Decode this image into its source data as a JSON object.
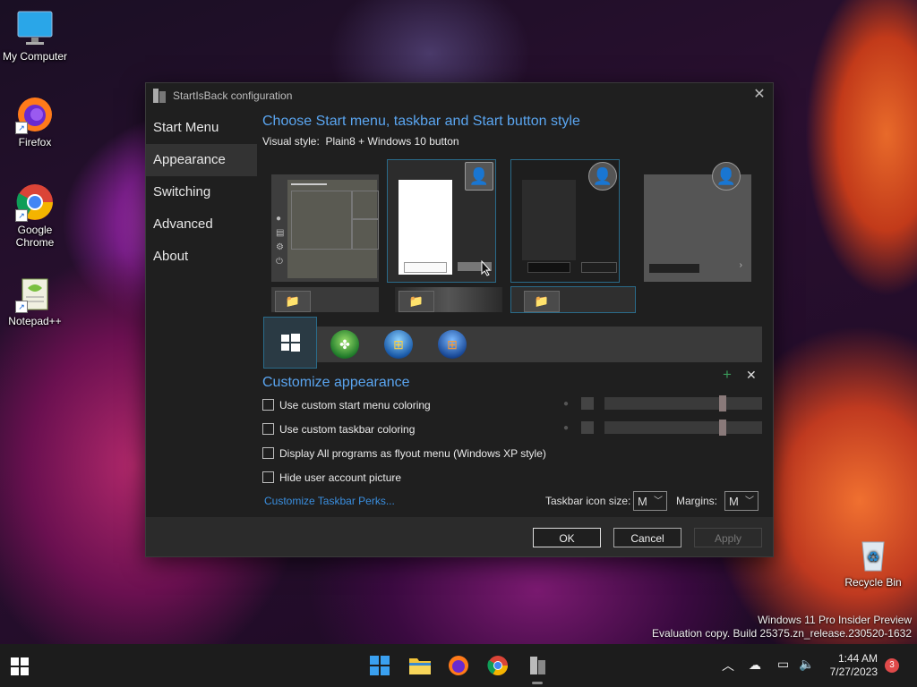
{
  "desktop": {
    "icons": [
      {
        "label": "My Computer"
      },
      {
        "label": "Firefox"
      },
      {
        "label": "Google Chrome"
      },
      {
        "label": "Notepad++"
      },
      {
        "label": "Recycle Bin"
      }
    ]
  },
  "window": {
    "title": "StartIsBack configuration",
    "nav": [
      "Start Menu",
      "Appearance",
      "Switching",
      "Advanced",
      "About"
    ],
    "active_nav": "Appearance",
    "heading": "Choose Start menu, taskbar and Start button style",
    "visual_style_label": "Visual style:",
    "visual_style_value": "Plain8 + Windows 10 button",
    "customize_heading": "Customize appearance",
    "checkboxes": [
      {
        "label": "Use custom start menu coloring",
        "checked": false
      },
      {
        "label": "Use custom taskbar coloring",
        "checked": false
      },
      {
        "label": "Display All programs as flyout menu (Windows XP style)",
        "checked": false
      },
      {
        "label": "Hide user account picture",
        "checked": false
      }
    ],
    "perks_link": "Customize Taskbar Perks...",
    "icon_size_label": "Taskbar icon size:",
    "icon_size_value": "M",
    "margins_label": "Margins:",
    "margins_value": "M",
    "ok_label": "OK",
    "cancel_label": "Cancel",
    "apply_label": "Apply",
    "add_symbol": "+",
    "remove_symbol": "✕"
  },
  "watermark": {
    "line1": "Windows 11 Pro Insider Preview",
    "line2": "Evaluation copy. Build 25375.zn_release.230520-1632"
  },
  "taskbar": {
    "time": "1:44 AM",
    "date": "7/27/2023",
    "notification_count": "3"
  },
  "colors": {
    "accent": "#5aa5f0",
    "link": "#3a8fe0",
    "selection_outline": "#2a6b8a"
  }
}
